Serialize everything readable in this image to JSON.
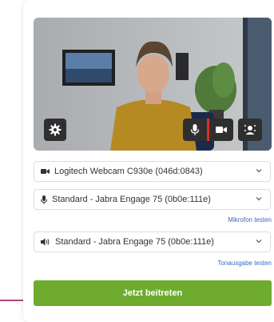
{
  "camera": {
    "label": "Logitech Webcam C930e (046d:0843)"
  },
  "microphone": {
    "label": "Standard - Jabra Engage 75 (0b0e:111e)",
    "test_link": "Mikrofon testen"
  },
  "speaker": {
    "label": "Standard - Jabra Engage 75 (0b0e:111e)",
    "test_link": "Tonausgabe testen"
  },
  "join_button": {
    "label": "Jetzt beitreten"
  },
  "colors": {
    "accent_green": "#6fab2e",
    "link_blue": "#3a66c4",
    "mute_red": "#d93025"
  },
  "icons": [
    "gear-icon",
    "microphone-icon",
    "camera-icon",
    "background-blur-icon",
    "video-camera-icon",
    "speaker-icon",
    "chevron-down-icon"
  ]
}
